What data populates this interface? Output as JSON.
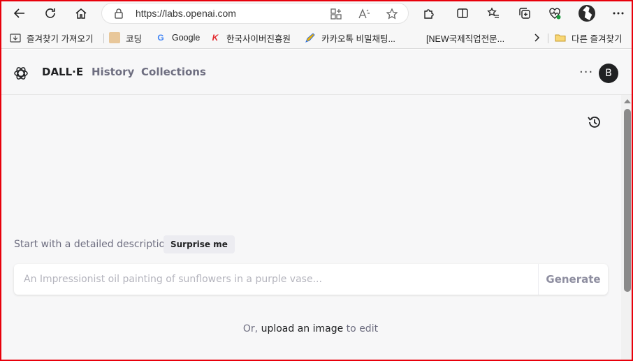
{
  "browser": {
    "url": "https://labs.openai.com",
    "bookmarks": [
      {
        "label": "즐겨찾기 가져오기",
        "icon": "import-icon"
      },
      {
        "label": "코딩",
        "icon": "dog-favicon"
      },
      {
        "label": "Google",
        "icon": "google-favicon"
      },
      {
        "label": "한국사이버진흥원",
        "icon": "k-favicon"
      },
      {
        "label": "카카오톡 비밀채팅...",
        "icon": "pen-favicon"
      },
      {
        "label": "[NEW국제직업전문...",
        "icon": "blank-favicon"
      },
      {
        "label": "다른 즐겨찾기",
        "icon": "folder-icon"
      }
    ]
  },
  "app": {
    "brand": "DALL·E",
    "nav": {
      "history": "History",
      "collections": "Collections"
    },
    "user_initial": "B",
    "more": "···"
  },
  "prompt": {
    "label": "Start with a detailed description",
    "surprise": "Surprise me",
    "placeholder": "An Impressionist oil painting of sunflowers in a purple vase...",
    "value": "",
    "generate": "Generate"
  },
  "upload": {
    "prefix": "Or, ",
    "link": "upload an image",
    "suffix": " to edit"
  },
  "colors": {
    "frame": "#e8000b",
    "page_bg": "#f7f7f8",
    "text": "#202123",
    "muted": "#6e6e80"
  }
}
